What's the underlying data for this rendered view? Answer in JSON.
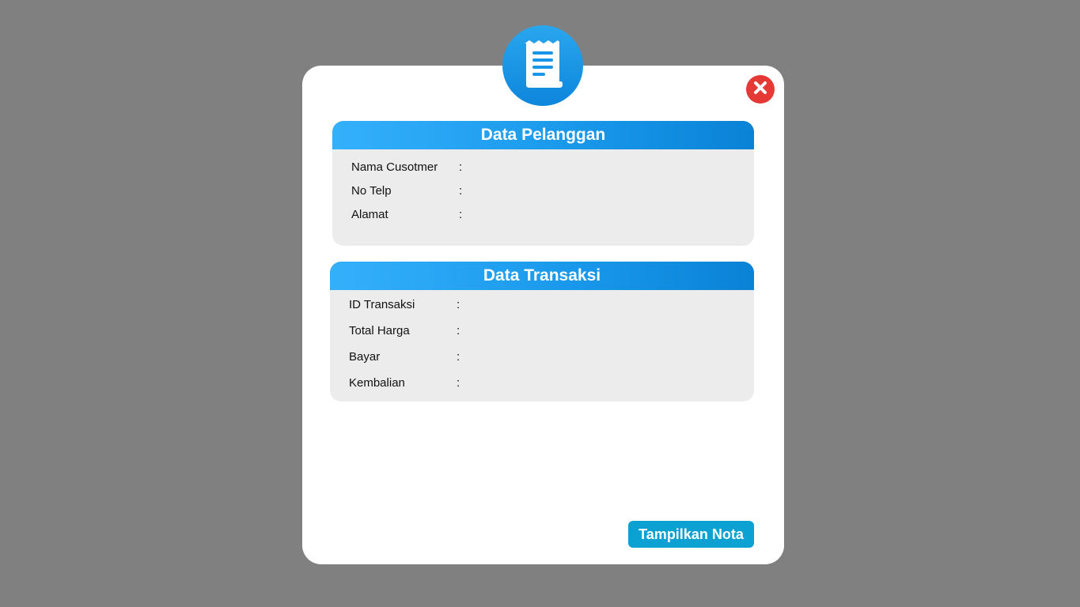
{
  "customer_panel": {
    "title": "Data Pelanggan",
    "fields": [
      {
        "label": "Nama Cusotmer",
        "separator": ":",
        "value": ""
      },
      {
        "label": "No Telp",
        "separator": ":",
        "value": ""
      },
      {
        "label": "Alamat",
        "separator": ":",
        "value": ""
      }
    ]
  },
  "transaction_panel": {
    "title": "Data Transaksi",
    "fields": [
      {
        "label": "ID Transaksi",
        "separator": ":",
        "value": ""
      },
      {
        "label": "Total Harga",
        "separator": ":",
        "value": ""
      },
      {
        "label": "Bayar",
        "separator": ":",
        "value": ""
      },
      {
        "label": "Kembalian",
        "separator": ":",
        "value": ""
      }
    ]
  },
  "actions": {
    "show_receipt_label": "Tampilkan Nota"
  },
  "icons": {
    "header": "receipt-icon",
    "close": "close-icon"
  },
  "colors": {
    "backdrop": "#808080",
    "accent_blue": "#1897ea",
    "button": "#0ba2d3",
    "close": "#e53935",
    "panel_bg": "#ececec"
  }
}
